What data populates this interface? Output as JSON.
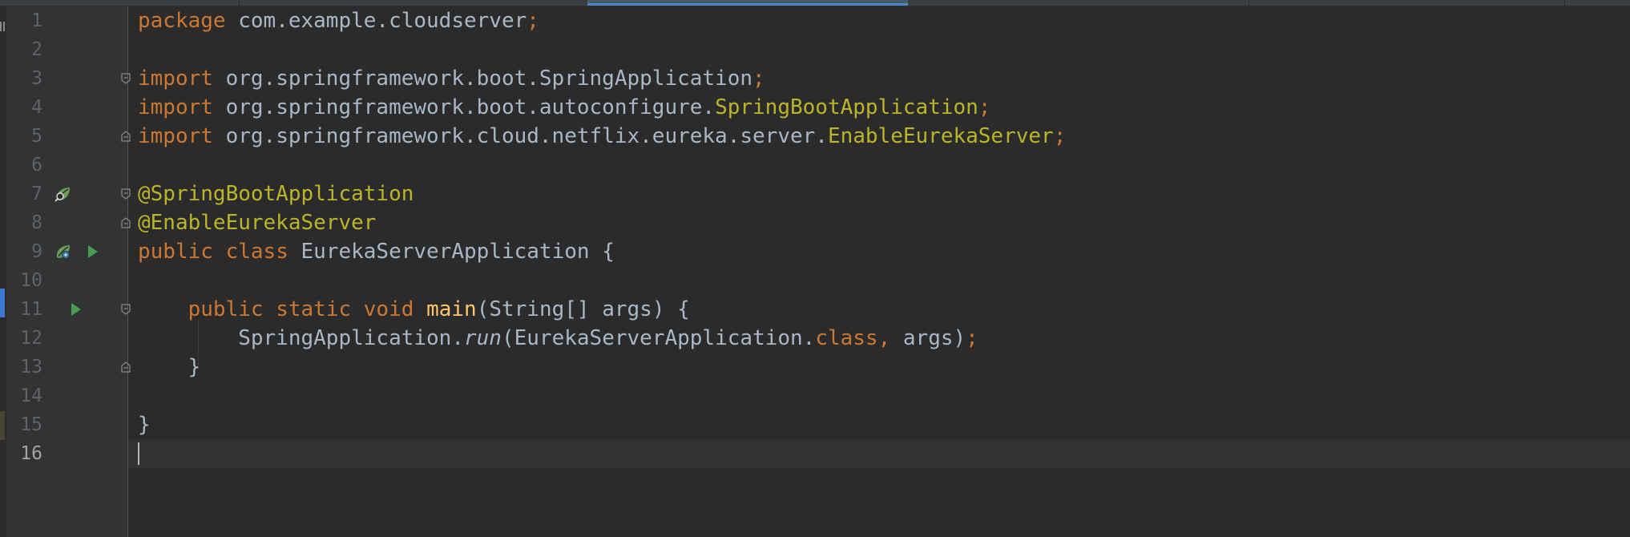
{
  "editor": {
    "current_line": 16,
    "lines": [
      {
        "n": "1",
        "tokens": [
          {
            "t": "package",
            "c": "kw"
          },
          {
            "t": " com.example.cloudserver",
            "c": "pl"
          },
          {
            "t": ";",
            "c": "kw"
          }
        ]
      },
      {
        "n": "2",
        "tokens": []
      },
      {
        "n": "3",
        "tokens": [
          {
            "t": "import",
            "c": "kw"
          },
          {
            "t": " org.springframework.boot.SpringApplication",
            "c": "pl"
          },
          {
            "t": ";",
            "c": "kw"
          }
        ]
      },
      {
        "n": "4",
        "tokens": [
          {
            "t": "import",
            "c": "kw"
          },
          {
            "t": " org.springframework.boot.autoconfigure.",
            "c": "pl"
          },
          {
            "t": "SpringBootApplication",
            "c": "yel"
          },
          {
            "t": ";",
            "c": "kw"
          }
        ]
      },
      {
        "n": "5",
        "tokens": [
          {
            "t": "import",
            "c": "kw"
          },
          {
            "t": " org.springframework.cloud.netflix.eureka.server.",
            "c": "pl"
          },
          {
            "t": "EnableEurekaServer",
            "c": "yel"
          },
          {
            "t": ";",
            "c": "kw"
          }
        ]
      },
      {
        "n": "6",
        "tokens": []
      },
      {
        "n": "7",
        "tokens": [
          {
            "t": "@SpringBootApplication",
            "c": "ann"
          }
        ]
      },
      {
        "n": "8",
        "tokens": [
          {
            "t": "@EnableEurekaServer",
            "c": "ann"
          }
        ]
      },
      {
        "n": "9",
        "tokens": [
          {
            "t": "public",
            "c": "kw"
          },
          {
            "t": " ",
            "c": "pl"
          },
          {
            "t": "class",
            "c": "kw"
          },
          {
            "t": " EurekaServerApplication {",
            "c": "pl"
          }
        ]
      },
      {
        "n": "10",
        "tokens": []
      },
      {
        "n": "11",
        "tokens": [
          {
            "t": "    ",
            "c": "pl"
          },
          {
            "t": "public",
            "c": "kw"
          },
          {
            "t": " ",
            "c": "pl"
          },
          {
            "t": "static",
            "c": "kw"
          },
          {
            "t": " ",
            "c": "pl"
          },
          {
            "t": "void",
            "c": "kw"
          },
          {
            "t": " ",
            "c": "pl"
          },
          {
            "t": "main",
            "c": "fn"
          },
          {
            "t": "(String[] args) {",
            "c": "pl"
          }
        ]
      },
      {
        "n": "12",
        "tokens": [
          {
            "t": "        SpringApplication.",
            "c": "pl"
          },
          {
            "t": "run",
            "c": "it"
          },
          {
            "t": "(EurekaServerApplication.",
            "c": "pl"
          },
          {
            "t": "class",
            "c": "kw"
          },
          {
            "t": ",",
            "c": "kw"
          },
          {
            "t": " args)",
            "c": "pl"
          },
          {
            "t": ";",
            "c": "kw"
          }
        ]
      },
      {
        "n": "13",
        "tokens": [
          {
            "t": "    }",
            "c": "pl"
          }
        ]
      },
      {
        "n": "14",
        "tokens": []
      },
      {
        "n": "15",
        "tokens": [
          {
            "t": "}",
            "c": "pl"
          }
        ]
      },
      {
        "n": "16",
        "tokens": []
      }
    ]
  },
  "gutter_icons": [
    {
      "line": 7,
      "kind": "spring-bean-search-icon"
    },
    {
      "line": 9,
      "kind": "spring-bean-icon"
    },
    {
      "line": 9,
      "kind": "run-icon"
    },
    {
      "line": 11,
      "kind": "run-icon"
    }
  ],
  "fold_markers": [
    3,
    5,
    7,
    8,
    11,
    13
  ],
  "colors": {
    "background": "#2b2b2b",
    "gutter": "#313335",
    "keyword": "#cc7832",
    "annotation": "#bbb529",
    "method": "#ffc66d",
    "plain": "#a9b7c6",
    "line_number": "#606366",
    "run_green": "#499c54",
    "bean_green": "#6a9f5b"
  }
}
